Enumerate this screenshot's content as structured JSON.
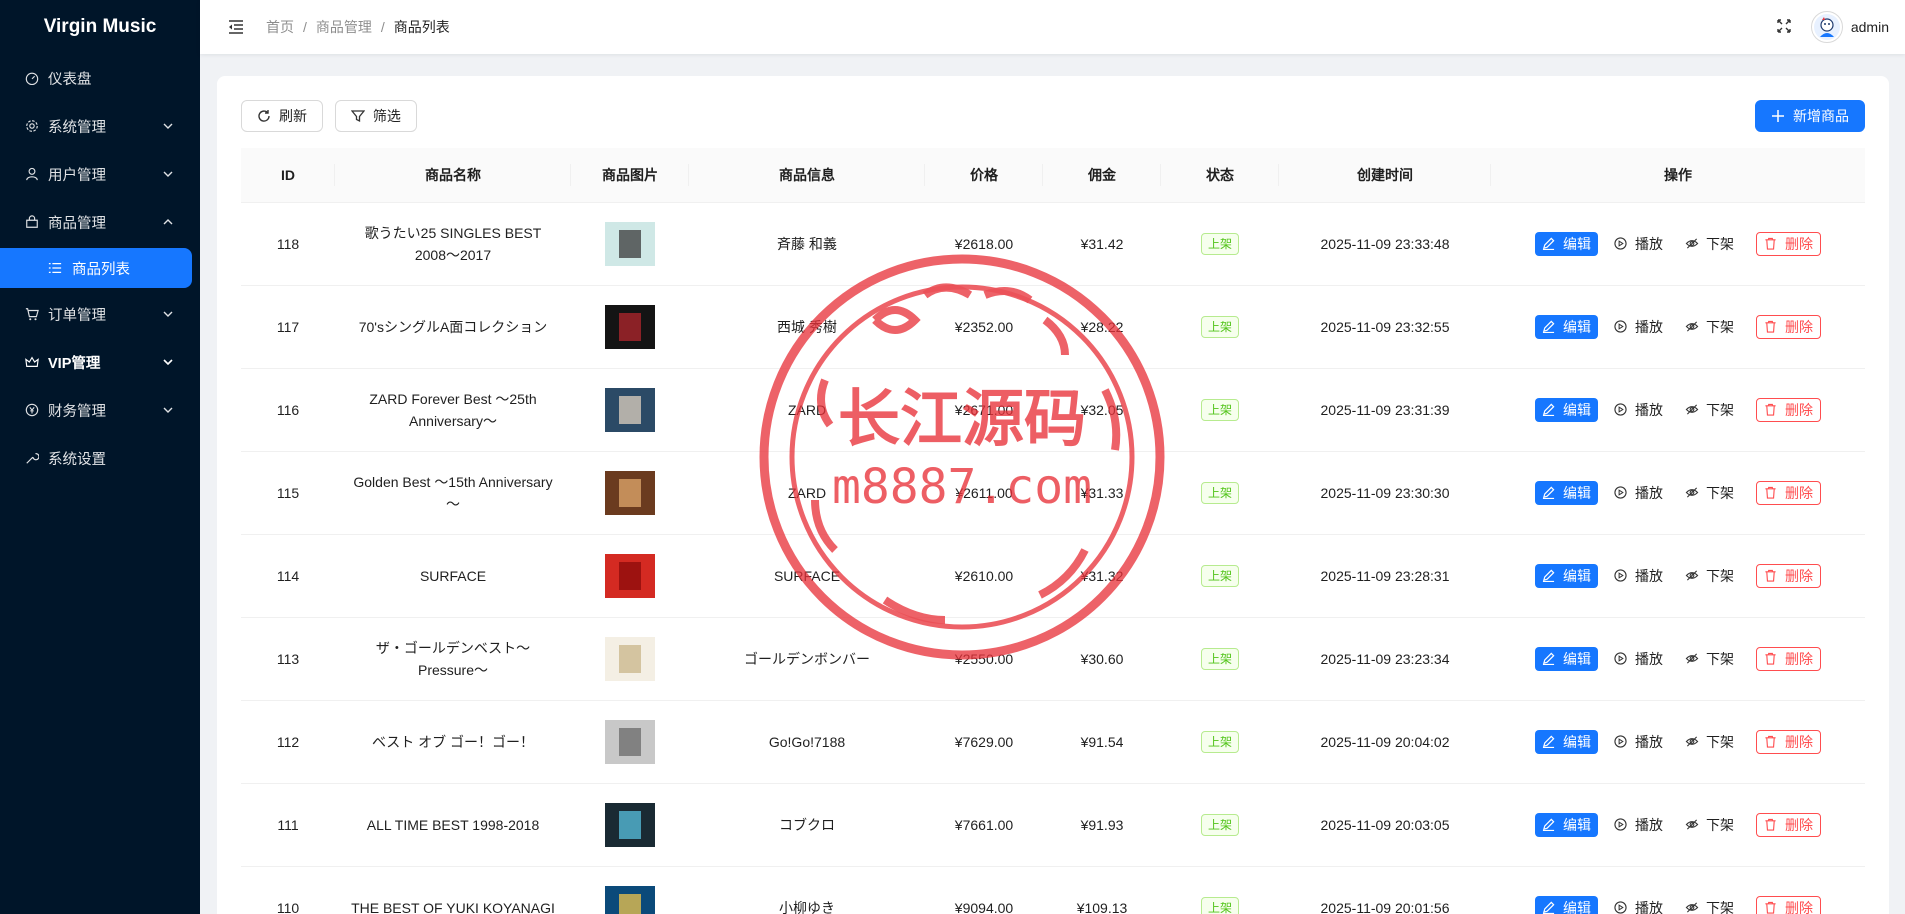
{
  "app": {
    "title": "Virgin Music"
  },
  "sidebar": {
    "items": [
      {
        "label": "仪表盘",
        "icon": "dashboard-icon"
      },
      {
        "label": "系统管理",
        "icon": "gear-icon"
      },
      {
        "label": "用户管理",
        "icon": "user-icon"
      },
      {
        "label": "商品管理",
        "icon": "shop-icon"
      },
      {
        "label": "商品列表",
        "icon": "list-icon"
      },
      {
        "label": "订单管理",
        "icon": "cart-icon"
      },
      {
        "label": "VIP管理",
        "icon": "crown-icon"
      },
      {
        "label": "财务管理",
        "icon": "money-icon"
      },
      {
        "label": "系统设置",
        "icon": "tool-icon"
      }
    ]
  },
  "header": {
    "breadcrumb": [
      "首页",
      "商品管理",
      "商品列表"
    ],
    "separator": "/",
    "username": "admin"
  },
  "toolbar": {
    "refresh": "刷新",
    "filter": "筛选",
    "add": "新增商品"
  },
  "table": {
    "columns": [
      "ID",
      "商品名称",
      "商品图片",
      "商品信息",
      "价格",
      "佣金",
      "状态",
      "创建时间",
      "操作"
    ],
    "actions": {
      "edit": "编辑",
      "play": "播放",
      "offline": "下架",
      "delete": "删除"
    },
    "rows": [
      {
        "id": "118",
        "name": "歌うたい25 SINGLES BEST 2008～2017",
        "info": "斉藤 和義",
        "price": "¥2618.00",
        "commission": "¥31.42",
        "status": "上架",
        "created": "2025-11-09 23:33:48"
      },
      {
        "id": "117",
        "name": "70'sシングルA面コレクション",
        "info": "西城 秀樹",
        "price": "¥2352.00",
        "commission": "¥28.22",
        "status": "上架",
        "created": "2025-11-09 23:32:55"
      },
      {
        "id": "116",
        "name": "ZARD Forever Best ～25th Anniversary～",
        "info": "ZARD",
        "price": "¥2671.00",
        "commission": "¥32.05",
        "status": "上架",
        "created": "2025-11-09 23:31:39"
      },
      {
        "id": "115",
        "name": "Golden Best ～15th Anniversary～",
        "info": "ZARD",
        "price": "¥2611.00",
        "commission": "¥31.33",
        "status": "上架",
        "created": "2025-11-09 23:30:30"
      },
      {
        "id": "114",
        "name": "SURFACE",
        "info": "SURFACE",
        "price": "¥2610.00",
        "commission": "¥31.32",
        "status": "上架",
        "created": "2025-11-09 23:28:31"
      },
      {
        "id": "113",
        "name": "ザ・ゴールデンベスト～Pressure～",
        "info": "ゴールデンボンバー",
        "price": "¥2550.00",
        "commission": "¥30.60",
        "status": "上架",
        "created": "2025-11-09 23:23:34"
      },
      {
        "id": "112",
        "name": "ベスト オブ ゴー！ゴー！",
        "info": "Go!Go!7188",
        "price": "¥7629.00",
        "commission": "¥91.54",
        "status": "上架",
        "created": "2025-11-09 20:04:02"
      },
      {
        "id": "111",
        "name": "ALL TIME BEST 1998-2018",
        "info": "コブクロ",
        "price": "¥7661.00",
        "commission": "¥91.93",
        "status": "上架",
        "created": "2025-11-09 20:03:05"
      },
      {
        "id": "110",
        "name": "THE BEST OF YUKI KOYANAGI",
        "info": "小柳ゆき",
        "price": "¥9094.00",
        "commission": "¥109.13",
        "status": "上架",
        "created": "2025-11-09 20:01:56"
      }
    ]
  },
  "watermark": {
    "title": "长江源码",
    "url": "m8887.com"
  },
  "colors": {
    "sidebar_bg": "#001529",
    "primary": "#1677ff",
    "danger": "#ff4d4f",
    "success": "#52c41a",
    "watermark": "#e8323a"
  }
}
